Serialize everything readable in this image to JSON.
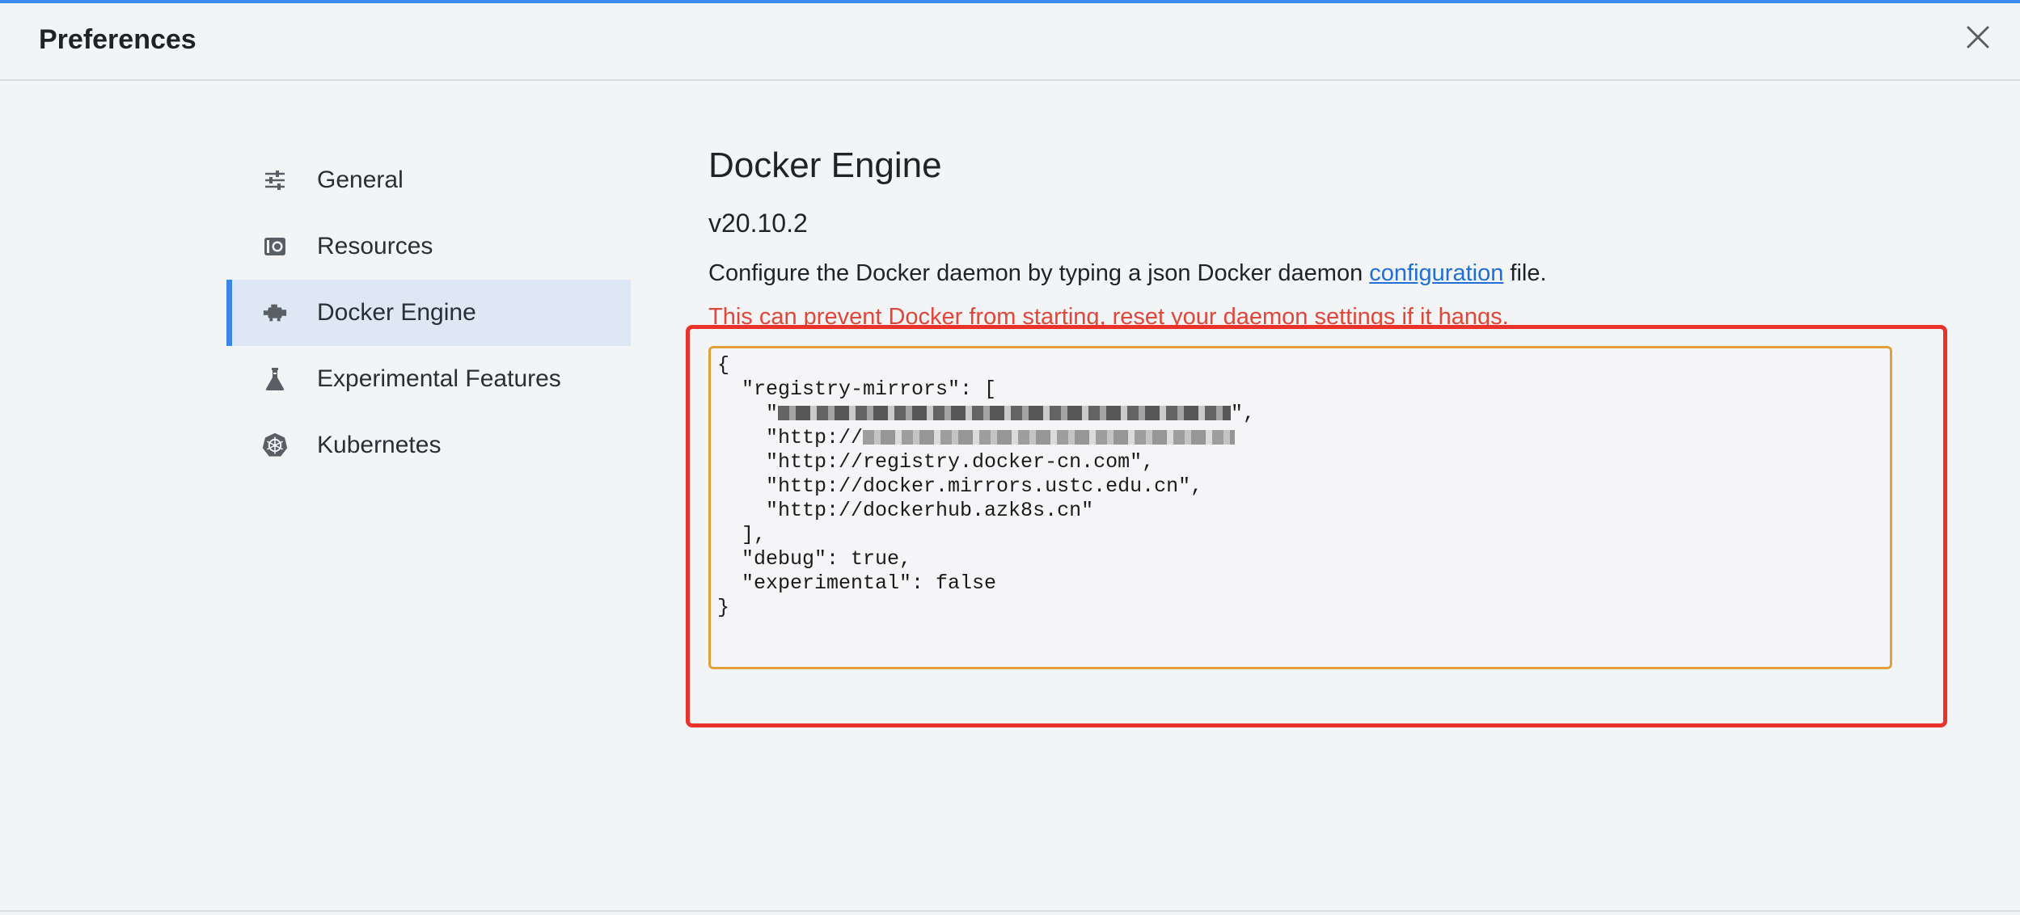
{
  "window": {
    "title": "Preferences",
    "close_label": "Close"
  },
  "colors": {
    "accent": "#3b8cf0",
    "active_nav_bg": "#dde8f4",
    "link": "#1f6fd6",
    "warning": "#e0463a",
    "editor_border": "#e0a13a",
    "annotation_red": "#e8322a"
  },
  "sidebar": {
    "items": [
      {
        "label": "General",
        "icon": "sliders-icon",
        "active": false
      },
      {
        "label": "Resources",
        "icon": "disk-icon",
        "active": false
      },
      {
        "label": "Docker Engine",
        "icon": "engine-icon",
        "active": true
      },
      {
        "label": "Experimental Features",
        "icon": "flask-icon",
        "active": false
      },
      {
        "label": "Kubernetes",
        "icon": "helm-wheel-icon",
        "active": false
      }
    ]
  },
  "main": {
    "title": "Docker Engine",
    "version": "v20.10.2",
    "description_before": "Configure the Docker daemon by typing a json Docker daemon ",
    "description_link": "configuration",
    "description_after": " file.",
    "warning": "This can prevent Docker from starting, reset your daemon settings if it hangs.",
    "config_lines": [
      "{",
      "  \"registry-mirrors\": [",
      "    \"",
      "    \"http://",
      "    \"http://registry.docker-cn.com\",",
      "    \"http://docker.mirrors.ustc.edu.cn\",",
      "    \"http://dockerhub.azk8s.cn\"",
      "  ],",
      "  \"debug\": true,",
      "  \"experimental\": false",
      "}"
    ]
  }
}
